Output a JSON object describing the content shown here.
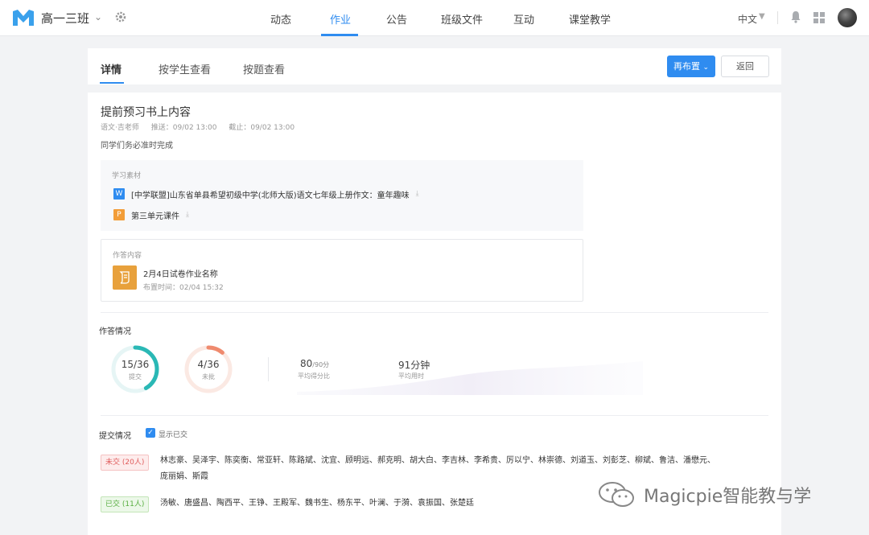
{
  "topbar": {
    "class_name": "高一三班",
    "nav": [
      {
        "label": "动态"
      },
      {
        "label": "作业"
      },
      {
        "label": "公告"
      },
      {
        "label": "班级文件"
      },
      {
        "label": "互动"
      },
      {
        "label": "课堂教学"
      }
    ],
    "active_nav": "作业",
    "language": "中文"
  },
  "tabs": {
    "items": [
      {
        "label": "详情"
      },
      {
        "label": "按学生查看"
      },
      {
        "label": "按题查看"
      }
    ],
    "active": "详情",
    "reassign_label": "再布置",
    "back_label": "返回"
  },
  "homework": {
    "title": "提前预习书上内容",
    "subject_teacher": "语文·吉老师",
    "pushed": "推送：09/02 13:00",
    "deadline": "截止：09/02 13:00",
    "description": "同学们务必准时完成"
  },
  "materials": {
    "label": "学习素材",
    "files": [
      {
        "type": "W",
        "name": "[中学联盟]山东省单县希望初级中学(北师大版)语文七年级上册作文：童年趣味"
      },
      {
        "type": "P",
        "name": "第三单元课件"
      }
    ]
  },
  "answer_content": {
    "label": "作答内容",
    "paper_title": "2月4日试卷作业名称",
    "assigned_time": "布置时间：02/04 15:32"
  },
  "answer_status": {
    "title": "作答情况",
    "submitted": {
      "value": "15/36",
      "label": "提交",
      "fraction": 0.4167,
      "color": "#2ab8b5"
    },
    "not_submitted": {
      "value": "4/36",
      "label": "未批",
      "fraction": 0.1111,
      "color": "#ef8a6e"
    },
    "avg_score": "80",
    "avg_score_total": "/90分",
    "avg_score_label": "平均得分比",
    "avg_time": "91分钟",
    "avg_time_label": "平均用时"
  },
  "submission": {
    "title": "提交情况",
    "show_submitted_label": "显示已交",
    "unsubmitted_tag": "未交 (20人)",
    "unsubmitted_names_line1": "林志豪、吴泽宇、陈奕衡、常亚轩、陈路斌、沈宜、顾明远、郝克明、胡大白、李吉林、李希贵、厉以宁、林崇德、刘道玉、刘彭芝、柳斌、鲁洁、潘懋元、",
    "unsubmitted_names_line2": "庞丽娟、斯霞",
    "submitted_tag": "已交 (11人)",
    "submitted_names": "汤敏、唐盛昌、陶西平、王铮、王殿军、魏书生、杨东平、叶澜、于漪、袁振国、张楚廷"
  },
  "watermark": {
    "text": "Magicpie智能教与学"
  },
  "colors": {
    "accent": "#2f8cf0",
    "teal": "#2ab8b5",
    "coral": "#ef8a6e"
  }
}
